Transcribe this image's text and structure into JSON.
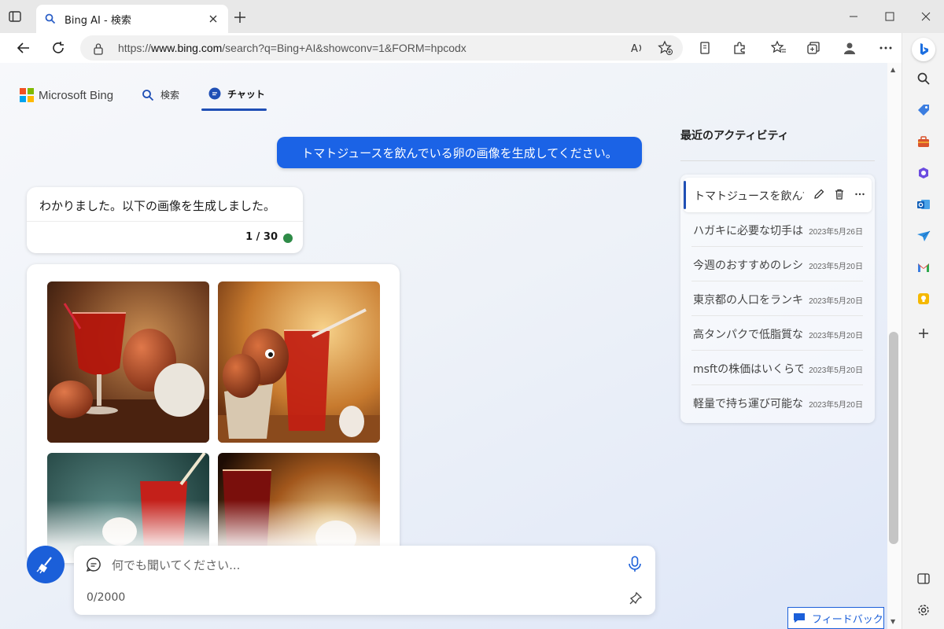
{
  "browser": {
    "tab_title": "Bing AI - 検索",
    "url_prefix": "https://",
    "url_domain": "www.bing.com",
    "url_rest": "/search?q=Bing+AI&showconv=1&FORM=hpcodx"
  },
  "header": {
    "logo_text": "Microsoft Bing",
    "nav_search": "検索",
    "nav_chat": "チャット"
  },
  "conversation": {
    "user_message": "トマトジュースを飲んでいる卵の画像を生成してください。",
    "bot_message": "わかりました。以下の画像を生成しました。",
    "turn_count": "1 / 30"
  },
  "input": {
    "placeholder": "何でも聞いてください...",
    "char_count": "0/2000"
  },
  "recent": {
    "title": "最近のアクティビティ",
    "active_item": "トマトジュースを飲んでいる卵の画像",
    "items": [
      {
        "text": "ハガキに必要な切手はいくら",
        "date": "2023年5月26日"
      },
      {
        "text": "今週のおすすめのレシピ",
        "date": "2023年5月20日"
      },
      {
        "text": "東京都の人口をランキング",
        "date": "2023年5月20日"
      },
      {
        "text": "高タンパクで低脂質な食品",
        "date": "2023年5月20日"
      },
      {
        "text": "msftの株価はいくらですか",
        "date": "2023年5月20日"
      },
      {
        "text": "軽量で持ち運び可能なPC",
        "date": "2023年5月20日"
      }
    ]
  },
  "feedback_label": "フィードバック",
  "colors": {
    "accent": "#1b63e6",
    "status_green": "#2e8b47",
    "nav_underline": "#1f4fb5"
  },
  "icons": [
    "sidebar-toggle-icon",
    "search-icon",
    "close-icon",
    "plus-icon",
    "minimize-icon",
    "maximize-icon",
    "back-icon",
    "refresh-icon",
    "lock-icon",
    "read-aloud-icon",
    "favorite-add-icon",
    "extensions-icon",
    "favorites-icon",
    "collections-icon",
    "profile-icon",
    "more-icon",
    "bing-icon",
    "chat-icon",
    "broom-icon",
    "mic-icon",
    "pin-icon",
    "edit-icon",
    "delete-icon",
    "settings-icon"
  ]
}
